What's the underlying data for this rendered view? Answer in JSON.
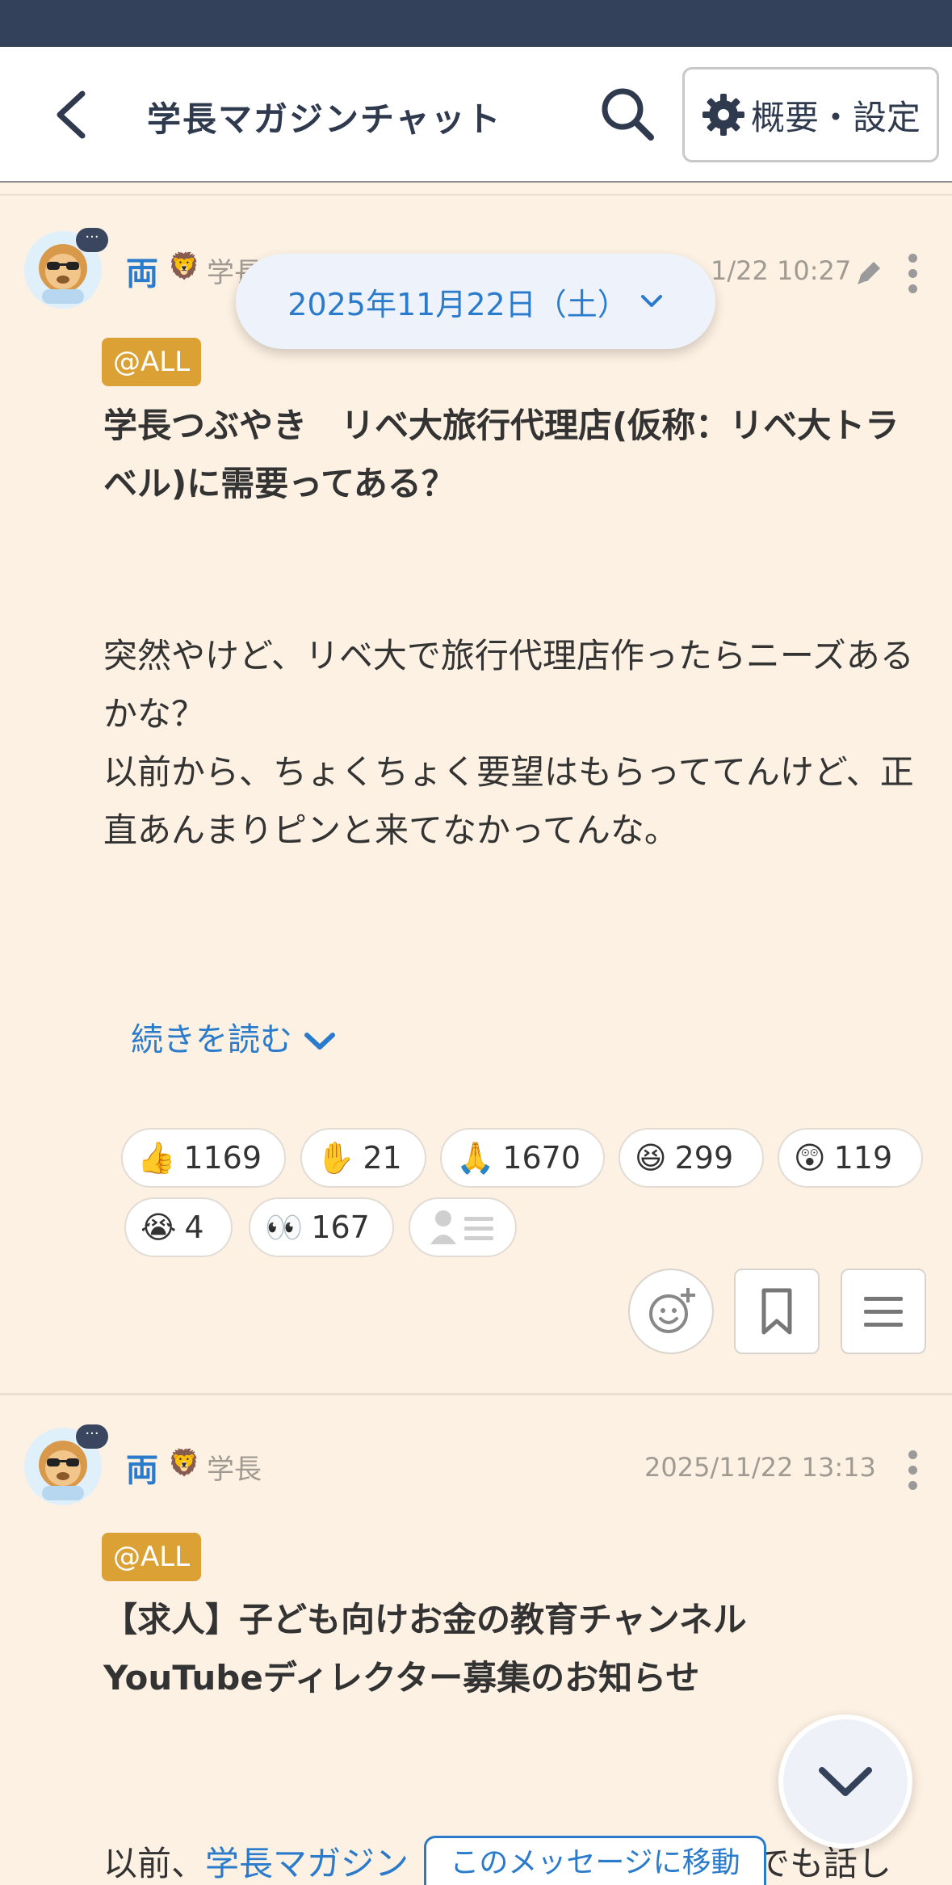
{
  "header": {
    "title": "学長マガジンチャット",
    "settings_label": "概要・設定"
  },
  "date_pill": {
    "label": "2025年11月22日（土）"
  },
  "messages": [
    {
      "author": "両",
      "role": "学長",
      "timestamp_visible": "1/22 10:27",
      "tag": "@ALL",
      "title": "学長つぶやき　リベ大旅行代理店(仮称：リベ大トラベル)に需要ってある？",
      "body": "突然やけど、リベ大で旅行代理店作ったらニーズあるかな？\n以前から、ちょくちょく要望はもらっててんけど、正直あんまりピンと来てなかってんな。",
      "read_more": "続きを読む",
      "reactions": [
        {
          "emoji": "👍",
          "count": "1169"
        },
        {
          "emoji": "✋",
          "count": "21"
        },
        {
          "emoji": "🙏",
          "count": "1670"
        },
        {
          "emoji": "😆",
          "count": "299"
        },
        {
          "emoji": "😲",
          "count": "119"
        },
        {
          "emoji": "😭",
          "count": "4"
        },
        {
          "emoji": "👀",
          "count": "167"
        }
      ]
    },
    {
      "author": "両",
      "role": "学長",
      "timestamp": "2025/11/22 13:13",
      "tag": "@ALL",
      "title": "【求人】子ども向けお金の教育チャンネルYouTubeディレクター募集のお知らせ",
      "body_prefix": "以前、",
      "body_link": "学長マガジン",
      "body_suffix": "でも話し"
    }
  ],
  "jump_label": "このメッセージに移動",
  "icons": {
    "back": "chevron-left-icon",
    "search": "search-icon",
    "settings": "gear-icon",
    "more": "kebab-icon",
    "edit": "pencil-icon",
    "add_reaction": "add-reaction-icon",
    "bookmark": "bookmark-icon",
    "menu": "hamburger-icon",
    "scroll": "chevron-down-icon"
  },
  "colors": {
    "status_bar": "#34415a",
    "background": "#fdf1e3",
    "accent": "#2a7bcb",
    "tag": "#dca135"
  }
}
